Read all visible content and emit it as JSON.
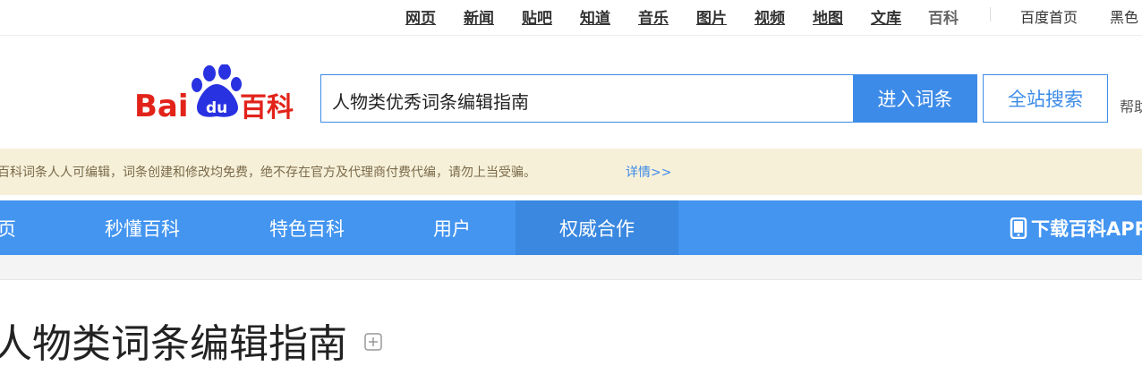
{
  "topnav": {
    "links": [
      {
        "label": "网页"
      },
      {
        "label": "新闻"
      },
      {
        "label": "贴吧"
      },
      {
        "label": "知道"
      },
      {
        "label": "音乐"
      },
      {
        "label": "图片"
      },
      {
        "label": "视频"
      },
      {
        "label": "地图"
      },
      {
        "label": "文库"
      },
      {
        "label": "百科"
      }
    ],
    "home_label": "百度首页",
    "theme_label": "黑色"
  },
  "header": {
    "logo_text_bai": "Bai",
    "logo_text_du": "du",
    "logo_text_baike": "百科",
    "search_value": "人物类优秀词条编辑指南",
    "enter_button": "进入词条",
    "site_search_button": "全站搜索",
    "help_label": "帮助"
  },
  "notice": {
    "message": "百科词条人人可编辑，词条创建和修改均免费，绝不存在官方及代理商付费代编，请勿上当受骗。",
    "more_link": "详情>>"
  },
  "mainnav": {
    "items": [
      {
        "label": "首页"
      },
      {
        "label": "秒懂百科"
      },
      {
        "label": "特色百科"
      },
      {
        "label": "用户"
      },
      {
        "label": "权威合作"
      }
    ],
    "download_label": "下载百科APP"
  },
  "content": {
    "title": "人物类词条编辑指南"
  },
  "colors": {
    "brand_blue": "#3d8be8",
    "nav_blue": "#4395f0",
    "logo_red": "#e2231a",
    "logo_blue": "#2932e1",
    "notice_bg": "#f7f0d9"
  }
}
